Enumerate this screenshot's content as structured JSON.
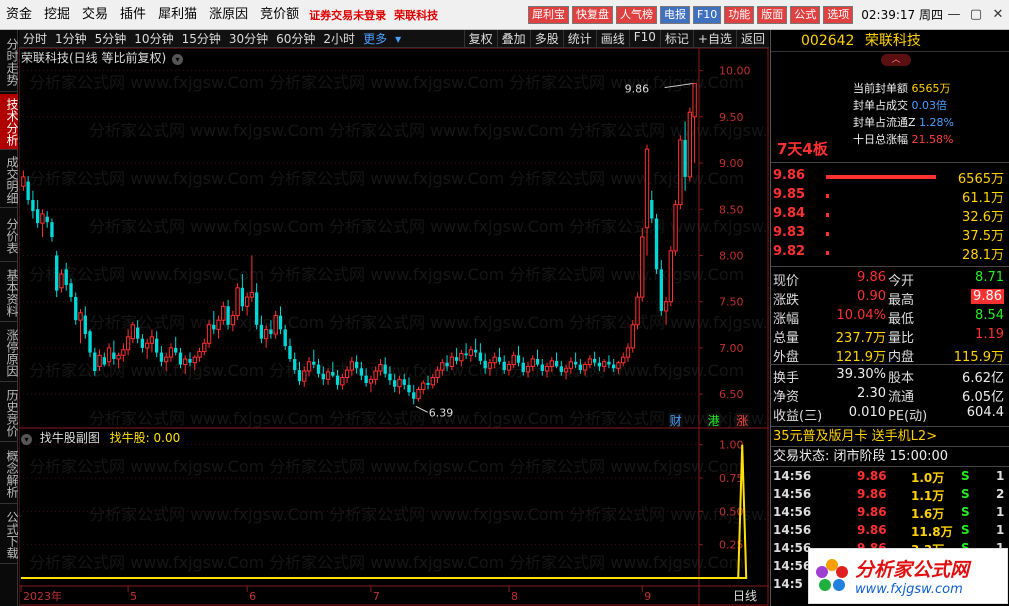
{
  "menu": {
    "items": [
      "资金",
      "挖掘",
      "交易",
      "插件",
      "犀利猫",
      "涨原因",
      "竞价额"
    ],
    "status_warn": "证券交易未登录",
    "stock_name": "荣联科技",
    "tools": [
      {
        "label": "犀利宝",
        "bg": "#e04040"
      },
      {
        "label": "快复盘",
        "bg": "#e04040"
      },
      {
        "label": "人气榜",
        "bg": "#e04040"
      },
      {
        "label": "电报",
        "bg": "#4070c0"
      },
      {
        "label": "F10",
        "bg": "#4070c0"
      },
      {
        "label": "功能",
        "bg": "#e04040"
      },
      {
        "label": "版面",
        "bg": "#e04040"
      },
      {
        "label": "公式",
        "bg": "#e04040"
      },
      {
        "label": "选项",
        "bg": "#e04040"
      }
    ],
    "clock": "02:39:17 周四"
  },
  "left_tabs": [
    {
      "label": "分时走势",
      "active": false
    },
    {
      "label": "技术分析",
      "active": true
    },
    {
      "label": "成交明细",
      "active": false
    },
    {
      "label": "分价表",
      "active": false
    },
    {
      "label": "基本资料",
      "active": false
    },
    {
      "label": "涨停原因",
      "active": false
    },
    {
      "label": "历史竞价",
      "active": false
    },
    {
      "label": "概念解析",
      "active": false
    },
    {
      "label": "公式下载",
      "active": false
    }
  ],
  "period_bar": {
    "periods": [
      "分时",
      "1分钟",
      "5分钟",
      "10分钟",
      "15分钟",
      "30分钟",
      "60分钟",
      "2小时"
    ],
    "more": "更多",
    "tools": [
      "复权",
      "叠加",
      "多股",
      "统计",
      "画线",
      "F10",
      "标记",
      "+自选",
      "返回"
    ]
  },
  "chart": {
    "title": "荣联科技(日线 等比前复权)",
    "sub_title": "找牛股副图",
    "sub_indicator": "找牛股: 0.00",
    "x_label": "日线",
    "watermark": "分析家公式网 www.fxjgsw.Com",
    "events": [
      {
        "label": "财",
        "color": "#4aa0ff"
      },
      {
        "label": "港",
        "color": "#22ee22"
      },
      {
        "label": "涨",
        "color": "#ff4040"
      }
    ],
    "markers": {
      "high": "9.86",
      "low": "6.39"
    }
  },
  "chart_data": {
    "type": "candlestick",
    "y_ticks": [
      "10.00",
      "9.50",
      "9.00",
      "8.50",
      "8.00",
      "7.50",
      "7.00",
      "6.50"
    ],
    "y_range": [
      6.22,
      10.05
    ],
    "x_ticks": [
      "2023年",
      "5",
      "6",
      "7",
      "8",
      "9"
    ],
    "x_tick_index": [
      0,
      22,
      47,
      73,
      102,
      130
    ],
    "candles": [
      [
        8.75,
        8.92,
        8.7,
        8.85
      ],
      [
        8.8,
        8.86,
        8.55,
        8.6
      ],
      [
        8.6,
        8.7,
        8.4,
        8.48
      ],
      [
        8.5,
        8.6,
        8.3,
        8.35
      ],
      [
        8.35,
        8.5,
        8.2,
        8.45
      ],
      [
        8.42,
        8.48,
        8.3,
        8.36
      ],
      [
        8.36,
        8.4,
        8.15,
        8.2
      ],
      [
        8.0,
        8.05,
        7.55,
        7.62
      ],
      [
        7.65,
        7.85,
        7.6,
        7.8
      ],
      [
        7.85,
        7.92,
        7.62,
        7.68
      ],
      [
        7.7,
        7.75,
        7.5,
        7.55
      ],
      [
        7.55,
        7.6,
        7.25,
        7.3
      ],
      [
        7.3,
        7.42,
        7.05,
        7.38
      ],
      [
        7.35,
        7.45,
        7.1,
        7.15
      ],
      [
        7.18,
        7.2,
        6.9,
        6.95
      ],
      [
        6.95,
        7.0,
        6.7,
        6.75
      ],
      [
        6.8,
        6.98,
        6.75,
        6.92
      ],
      [
        6.9,
        6.95,
        6.8,
        6.82
      ],
      [
        6.85,
        7.05,
        6.8,
        7.0
      ],
      [
        6.95,
        7.08,
        6.82,
        6.88
      ],
      [
        6.88,
        6.95,
        6.78,
        6.92
      ],
      [
        6.92,
        7.05,
        6.85,
        6.98
      ],
      [
        6.98,
        7.2,
        6.92,
        7.12
      ],
      [
        7.1,
        7.28,
        7.05,
        7.25
      ],
      [
        7.22,
        7.3,
        7.05,
        7.1
      ],
      [
        7.1,
        7.15,
        6.95,
        7.0
      ],
      [
        7.0,
        7.1,
        6.88,
        7.05
      ],
      [
        7.05,
        7.2,
        6.95,
        7.12
      ],
      [
        7.1,
        7.18,
        6.9,
        6.95
      ],
      [
        6.95,
        7.02,
        6.8,
        6.85
      ],
      [
        6.85,
        6.95,
        6.75,
        6.9
      ],
      [
        6.9,
        7.05,
        6.85,
        7.0
      ],
      [
        7.0,
        7.12,
        6.92,
        6.95
      ],
      [
        6.95,
        7.0,
        6.78,
        6.82
      ],
      [
        6.82,
        6.92,
        6.72,
        6.88
      ],
      [
        6.88,
        6.95,
        6.8,
        6.84
      ],
      [
        6.84,
        6.92,
        6.76,
        6.9
      ],
      [
        6.9,
        7.0,
        6.85,
        6.96
      ],
      [
        6.96,
        7.1,
        6.92,
        7.05
      ],
      [
        7.05,
        7.3,
        7.0,
        7.25
      ],
      [
        7.25,
        7.4,
        7.15,
        7.2
      ],
      [
        7.2,
        7.35,
        7.1,
        7.3
      ],
      [
        7.3,
        7.5,
        7.25,
        7.45
      ],
      [
        7.45,
        7.52,
        7.2,
        7.25
      ],
      [
        7.25,
        7.4,
        7.18,
        7.35
      ],
      [
        7.35,
        7.7,
        7.3,
        7.65
      ],
      [
        7.65,
        7.8,
        7.4,
        7.45
      ],
      [
        7.45,
        7.6,
        7.35,
        7.55
      ],
      [
        7.55,
        8.0,
        7.5,
        7.6
      ],
      [
        7.6,
        7.7,
        7.2,
        7.25
      ],
      [
        7.25,
        7.35,
        7.05,
        7.1
      ],
      [
        7.1,
        7.25,
        7.0,
        7.2
      ],
      [
        7.2,
        7.3,
        7.1,
        7.15
      ],
      [
        7.15,
        7.4,
        7.1,
        7.35
      ],
      [
        7.35,
        7.45,
        7.15,
        7.2
      ],
      [
        7.2,
        7.25,
        6.98,
        7.02
      ],
      [
        7.02,
        7.1,
        6.85,
        6.88
      ],
      [
        6.88,
        6.95,
        6.72,
        6.76
      ],
      [
        6.76,
        6.85,
        6.6,
        6.64
      ],
      [
        6.64,
        6.8,
        6.58,
        6.75
      ],
      [
        6.75,
        6.9,
        6.7,
        6.85
      ],
      [
        6.85,
        6.98,
        6.78,
        6.82
      ],
      [
        6.82,
        6.88,
        6.68,
        6.72
      ],
      [
        6.72,
        6.8,
        6.6,
        6.66
      ],
      [
        6.66,
        6.78,
        6.6,
        6.74
      ],
      [
        6.74,
        6.85,
        6.68,
        6.7
      ],
      [
        6.7,
        6.76,
        6.55,
        6.6
      ],
      [
        6.6,
        6.72,
        6.55,
        6.68
      ],
      [
        6.68,
        6.8,
        6.62,
        6.76
      ],
      [
        6.76,
        6.9,
        6.7,
        6.85
      ],
      [
        6.85,
        6.92,
        6.72,
        6.78
      ],
      [
        6.78,
        6.85,
        6.65,
        6.7
      ],
      [
        6.7,
        6.78,
        6.58,
        6.62
      ],
      [
        6.62,
        6.7,
        6.52,
        6.66
      ],
      [
        6.66,
        6.8,
        6.6,
        6.75
      ],
      [
        6.75,
        6.88,
        6.7,
        6.82
      ],
      [
        6.82,
        6.9,
        6.68,
        6.72
      ],
      [
        6.72,
        6.8,
        6.6,
        6.65
      ],
      [
        6.65,
        6.72,
        6.52,
        6.58
      ],
      [
        6.58,
        6.7,
        6.5,
        6.66
      ],
      [
        6.66,
        6.72,
        6.55,
        6.6
      ],
      [
        6.6,
        6.68,
        6.48,
        6.52
      ],
      [
        6.52,
        6.6,
        6.39,
        6.45
      ],
      [
        6.45,
        6.58,
        6.42,
        6.55
      ],
      [
        6.55,
        6.65,
        6.5,
        6.62
      ],
      [
        6.62,
        6.7,
        6.55,
        6.6
      ],
      [
        6.6,
        6.72,
        6.56,
        6.68
      ],
      [
        6.68,
        6.8,
        6.62,
        6.76
      ],
      [
        6.76,
        6.88,
        6.7,
        6.84
      ],
      [
        6.84,
        6.92,
        6.75,
        6.8
      ],
      [
        6.8,
        6.95,
        6.76,
        6.9
      ],
      [
        6.9,
        7.0,
        6.82,
        6.86
      ],
      [
        6.86,
        6.98,
        6.8,
        6.94
      ],
      [
        6.94,
        7.05,
        6.88,
        6.92
      ],
      [
        6.92,
        7.02,
        6.85,
        6.98
      ],
      [
        6.98,
        7.1,
        6.9,
        6.95
      ],
      [
        6.95,
        7.05,
        6.82,
        6.86
      ],
      [
        6.86,
        6.94,
        6.72,
        6.78
      ],
      [
        6.78,
        6.88,
        6.7,
        6.84
      ],
      [
        6.84,
        6.95,
        6.78,
        6.9
      ],
      [
        6.9,
        7.0,
        6.82,
        6.85
      ],
      [
        6.85,
        6.92,
        6.72,
        6.76
      ],
      [
        6.76,
        6.86,
        6.7,
        6.82
      ],
      [
        6.82,
        6.96,
        6.78,
        6.92
      ],
      [
        6.92,
        7.02,
        6.8,
        6.84
      ],
      [
        6.84,
        6.9,
        6.7,
        6.74
      ],
      [
        6.74,
        6.85,
        6.68,
        6.8
      ],
      [
        6.8,
        6.92,
        6.75,
        6.88
      ],
      [
        6.88,
        6.98,
        6.8,
        6.82
      ],
      [
        6.82,
        6.88,
        6.7,
        6.75
      ],
      [
        6.75,
        6.84,
        6.68,
        6.8
      ],
      [
        6.8,
        6.9,
        6.74,
        6.86
      ],
      [
        6.86,
        6.95,
        6.78,
        6.8
      ],
      [
        6.8,
        6.86,
        6.7,
        6.74
      ],
      [
        6.74,
        6.82,
        6.66,
        6.78
      ],
      [
        6.78,
        6.9,
        6.72,
        6.85
      ],
      [
        6.85,
        6.95,
        6.78,
        6.82
      ],
      [
        6.82,
        6.88,
        6.72,
        6.76
      ],
      [
        6.76,
        6.85,
        6.7,
        6.82
      ],
      [
        6.82,
        6.92,
        6.78,
        6.88
      ],
      [
        6.88,
        6.96,
        6.8,
        6.84
      ],
      [
        6.84,
        6.9,
        6.75,
        6.8
      ],
      [
        6.8,
        6.88,
        6.74,
        6.85
      ],
      [
        6.85,
        6.92,
        6.78,
        6.82
      ],
      [
        6.82,
        6.88,
        6.74,
        6.78
      ],
      [
        6.78,
        6.86,
        6.72,
        6.84
      ],
      [
        6.84,
        6.95,
        6.8,
        6.9
      ],
      [
        6.9,
        7.05,
        6.85,
        7.0
      ],
      [
        7.0,
        7.3,
        6.95,
        7.25
      ],
      [
        7.25,
        7.6,
        7.2,
        7.55
      ],
      [
        7.55,
        8.3,
        7.5,
        8.2
      ],
      [
        8.3,
        9.2,
        8.0,
        9.15
      ],
      [
        8.6,
        8.7,
        8.35,
        8.4
      ],
      [
        8.4,
        8.45,
        7.8,
        7.85
      ],
      [
        7.85,
        7.95,
        7.35,
        7.4
      ],
      [
        7.4,
        7.55,
        7.25,
        7.5
      ],
      [
        7.5,
        8.1,
        7.45,
        8.05
      ],
      [
        8.05,
        8.6,
        8.0,
        8.55
      ],
      [
        8.55,
        9.3,
        8.5,
        9.25
      ],
      [
        9.25,
        9.45,
        8.7,
        8.85
      ],
      [
        8.85,
        9.6,
        8.8,
        9.55
      ],
      [
        9.5,
        9.86,
        9.0,
        9.86
      ]
    ],
    "sub_series": {
      "name": "找牛股",
      "y_ticks": [
        "1.00",
        "0.75",
        "0.50",
        "0.25"
      ],
      "y_range": [
        0,
        1.05
      ],
      "spike_index": 151,
      "spike_value": 1.0
    }
  },
  "right_panel": {
    "code": "002642",
    "name": "荣联科技",
    "boards": "7天4板",
    "sealed": [
      {
        "label": "当前封单额",
        "value": "6565万",
        "cls": "yel"
      },
      {
        "label": "封单占成交",
        "value": "0.03倍",
        "cls": ""
      },
      {
        "label": "封单占流通Z",
        "value": "1.28%",
        "cls": ""
      },
      {
        "label": "十日总涨幅",
        "value": "21.58%",
        "cls": "red"
      }
    ],
    "bids": [
      {
        "price": "9.86",
        "vol": "6565万",
        "bar": 110
      },
      {
        "price": "9.85",
        "vol": "61.1万",
        "bar": 3
      },
      {
        "price": "9.84",
        "vol": "32.6万",
        "bar": 3
      },
      {
        "price": "9.83",
        "vol": "37.5万",
        "bar": 3
      },
      {
        "price": "9.82",
        "vol": "28.1万",
        "bar": 3
      }
    ],
    "quote": [
      {
        "l1": "现价",
        "v1": "9.86",
        "c1": "red",
        "l2": "今开",
        "v2": "8.71",
        "c2": "grn"
      },
      {
        "l1": "涨跌",
        "v1": "0.90",
        "c1": "red",
        "l2": "最高",
        "v2": "9.86",
        "c2": "hi"
      },
      {
        "l1": "涨幅",
        "v1": "10.04%",
        "c1": "red",
        "l2": "最低",
        "v2": "8.54",
        "c2": "grn"
      },
      {
        "l1": "总量",
        "v1": "237.7万",
        "c1": "yel",
        "l2": "量比",
        "v2": "1.19",
        "c2": "red"
      },
      {
        "l1": "外盘",
        "v1": "121.9万",
        "c1": "yel",
        "l2": "内盘",
        "v2": "115.9万",
        "c2": "yel"
      }
    ],
    "fund": [
      {
        "l1": "换手",
        "v1": "39.30%",
        "l2": "股本",
        "v2": "6.62亿"
      },
      {
        "l1": "净资",
        "v1": "2.30",
        "l2": "流通",
        "v2": "6.05亿"
      },
      {
        "l1": "收益(三)",
        "v1": "0.010",
        "l2": "PE(动)",
        "v2": "604.4"
      }
    ],
    "ad": "35元普及版月卡 送手机L2>",
    "trade_status": "交易状态: 闭市阶段 15:00:00",
    "ticks": [
      {
        "time": "14:56",
        "price": "9.86",
        "vol": "1.0万",
        "dir": "S",
        "n": "1"
      },
      {
        "time": "14:56",
        "price": "9.86",
        "vol": "1.1万",
        "dir": "S",
        "n": "2"
      },
      {
        "time": "14:56",
        "price": "9.86",
        "vol": "1.6万",
        "dir": "S",
        "n": "1"
      },
      {
        "time": "14:56",
        "price": "9.86",
        "vol": "11.8万",
        "dir": "S",
        "n": "1"
      },
      {
        "time": "14:56",
        "price": "9.86",
        "vol": "3.3万",
        "dir": "S",
        "n": "1"
      },
      {
        "time": "14:56",
        "price": "9.86",
        "vol": "2.1万",
        "dir": "S",
        "n": "1"
      },
      {
        "time": "14:5",
        "price": "9.86",
        "vol": "1.4万",
        "dir": "S",
        "n": "1"
      }
    ]
  },
  "logo": {
    "cn": "分析家公式网",
    "url": "www.fxjgsw.com"
  }
}
